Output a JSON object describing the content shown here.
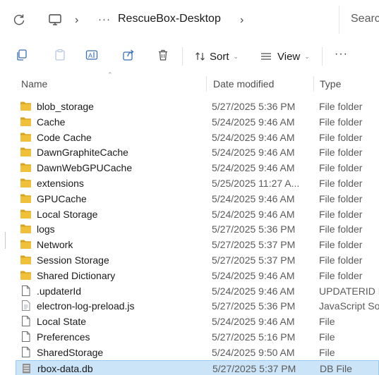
{
  "address_bar": {
    "refresh_icon": "refresh-icon",
    "pc_icon": "computer-icon",
    "ellipsis": "···",
    "crumb": "RescueBox-Desktop",
    "search_placeholder": "Search"
  },
  "toolbar": {
    "icons": [
      "copy-icon",
      "paste-icon",
      "rename-icon",
      "share-icon",
      "delete-icon"
    ],
    "sort_label": "Sort",
    "view_label": "View",
    "more": "···"
  },
  "columns": {
    "name": "Name",
    "date_modified": "Date modified",
    "type": "Type"
  },
  "files": [
    {
      "name": "blob_storage",
      "date": "5/27/2025 5:36 PM",
      "type": "File folder",
      "icon": "folder"
    },
    {
      "name": "Cache",
      "date": "5/24/2025 9:46 AM",
      "type": "File folder",
      "icon": "folder"
    },
    {
      "name": "Code Cache",
      "date": "5/24/2025 9:46 AM",
      "type": "File folder",
      "icon": "folder"
    },
    {
      "name": "DawnGraphiteCache",
      "date": "5/24/2025 9:46 AM",
      "type": "File folder",
      "icon": "folder"
    },
    {
      "name": "DawnWebGPUCache",
      "date": "5/24/2025 9:46 AM",
      "type": "File folder",
      "icon": "folder"
    },
    {
      "name": "extensions",
      "date": "5/25/2025 11:27 A...",
      "type": "File folder",
      "icon": "folder"
    },
    {
      "name": "GPUCache",
      "date": "5/24/2025 9:46 AM",
      "type": "File folder",
      "icon": "folder"
    },
    {
      "name": "Local Storage",
      "date": "5/24/2025 9:46 AM",
      "type": "File folder",
      "icon": "folder"
    },
    {
      "name": "logs",
      "date": "5/27/2025 5:36 PM",
      "type": "File folder",
      "icon": "folder"
    },
    {
      "name": "Network",
      "date": "5/27/2025 5:37 PM",
      "type": "File folder",
      "icon": "folder"
    },
    {
      "name": "Session Storage",
      "date": "5/27/2025 5:37 PM",
      "type": "File folder",
      "icon": "folder"
    },
    {
      "name": "Shared Dictionary",
      "date": "5/24/2025 9:46 AM",
      "type": "File folder",
      "icon": "folder"
    },
    {
      "name": ".updaterId",
      "date": "5/24/2025 9:46 AM",
      "type": "UPDATERID File",
      "icon": "file"
    },
    {
      "name": "electron-log-preload.js",
      "date": "5/27/2025 5:36 PM",
      "type": "JavaScript Source File",
      "icon": "js"
    },
    {
      "name": "Local State",
      "date": "5/24/2025 9:46 AM",
      "type": "File",
      "icon": "file"
    },
    {
      "name": "Preferences",
      "date": "5/27/2025 5:16 PM",
      "type": "File",
      "icon": "file"
    },
    {
      "name": "SharedStorage",
      "date": "5/24/2025 9:50 AM",
      "type": "File",
      "icon": "file"
    },
    {
      "name": "rbox-data.db",
      "date": "5/27/2025 5:37 PM",
      "type": "DB File",
      "icon": "db",
      "selected": true
    }
  ],
  "colors": {
    "folder": "#f0c038",
    "folder_dark": "#d9a520",
    "selection_bg": "#cce4f7",
    "selection_border": "#99c9ef"
  }
}
